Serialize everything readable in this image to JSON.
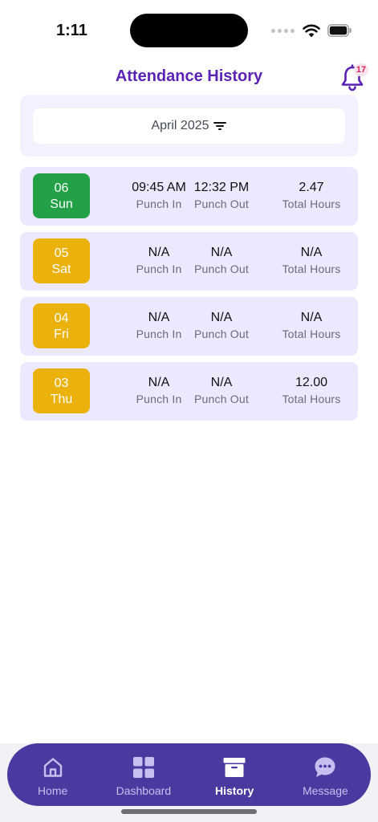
{
  "status_bar": {
    "time": "1:11"
  },
  "header": {
    "title": "Attendance History",
    "notification_count": "17"
  },
  "filter": {
    "month": "April 2025"
  },
  "labels": {
    "punch_in": "Punch In",
    "punch_out": "Punch Out",
    "total_hours": "Total Hours"
  },
  "records": [
    {
      "date": "06",
      "day": "Sun",
      "status_color": "#22a147",
      "punch_in": "09:45 AM",
      "punch_out": "12:32 PM",
      "total": "2.47"
    },
    {
      "date": "05",
      "day": "Sat",
      "status_color": "#ebb20c",
      "punch_in": "N/A",
      "punch_out": "N/A",
      "total": "N/A"
    },
    {
      "date": "04",
      "day": "Fri",
      "status_color": "#ebb20c",
      "punch_in": "N/A",
      "punch_out": "N/A",
      "total": "N/A"
    },
    {
      "date": "03",
      "day": "Thu",
      "status_color": "#ebb20c",
      "punch_in": "N/A",
      "punch_out": "N/A",
      "total": "12.00"
    }
  ],
  "nav": {
    "active": "History",
    "items": [
      {
        "label": "Home",
        "icon": "home-icon"
      },
      {
        "label": "Dashboard",
        "icon": "grid-icon"
      },
      {
        "label": "History",
        "icon": "archive-icon"
      },
      {
        "label": "Message",
        "icon": "chat-bubble-icon"
      }
    ]
  },
  "colors": {
    "accent": "#5b23b5",
    "nav_bg": "#4a3aa0",
    "card_bg": "#ece8fd"
  }
}
